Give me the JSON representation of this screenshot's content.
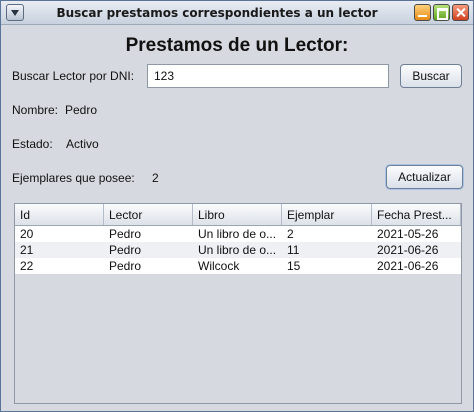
{
  "window": {
    "title": "Buscar prestamos correspondientes a un lector"
  },
  "page": {
    "heading": "Prestamos de un Lector:"
  },
  "search": {
    "label": "Buscar Lector por DNI:",
    "value": "123",
    "button_label": "Buscar"
  },
  "lector": {
    "nombre_label": "Nombre:",
    "nombre_value": "Pedro",
    "estado_label": "Estado:",
    "estado_value": "Activo",
    "ejemplares_label": "Ejemplares que posee:",
    "ejemplares_value": "2"
  },
  "actions": {
    "actualizar_label": "Actualizar"
  },
  "table": {
    "columns": [
      "Id",
      "Lector",
      "Libro",
      "Ejemplar",
      "Fecha Prest..."
    ],
    "rows": [
      [
        "20",
        "Pedro",
        "Un libro de o...",
        "2",
        "2021-05-26"
      ],
      [
        "21",
        "Pedro",
        "Un libro de o...",
        "11",
        "2021-06-26"
      ],
      [
        "22",
        "Pedro",
        "Wilcock",
        "15",
        "2021-06-26"
      ]
    ]
  }
}
